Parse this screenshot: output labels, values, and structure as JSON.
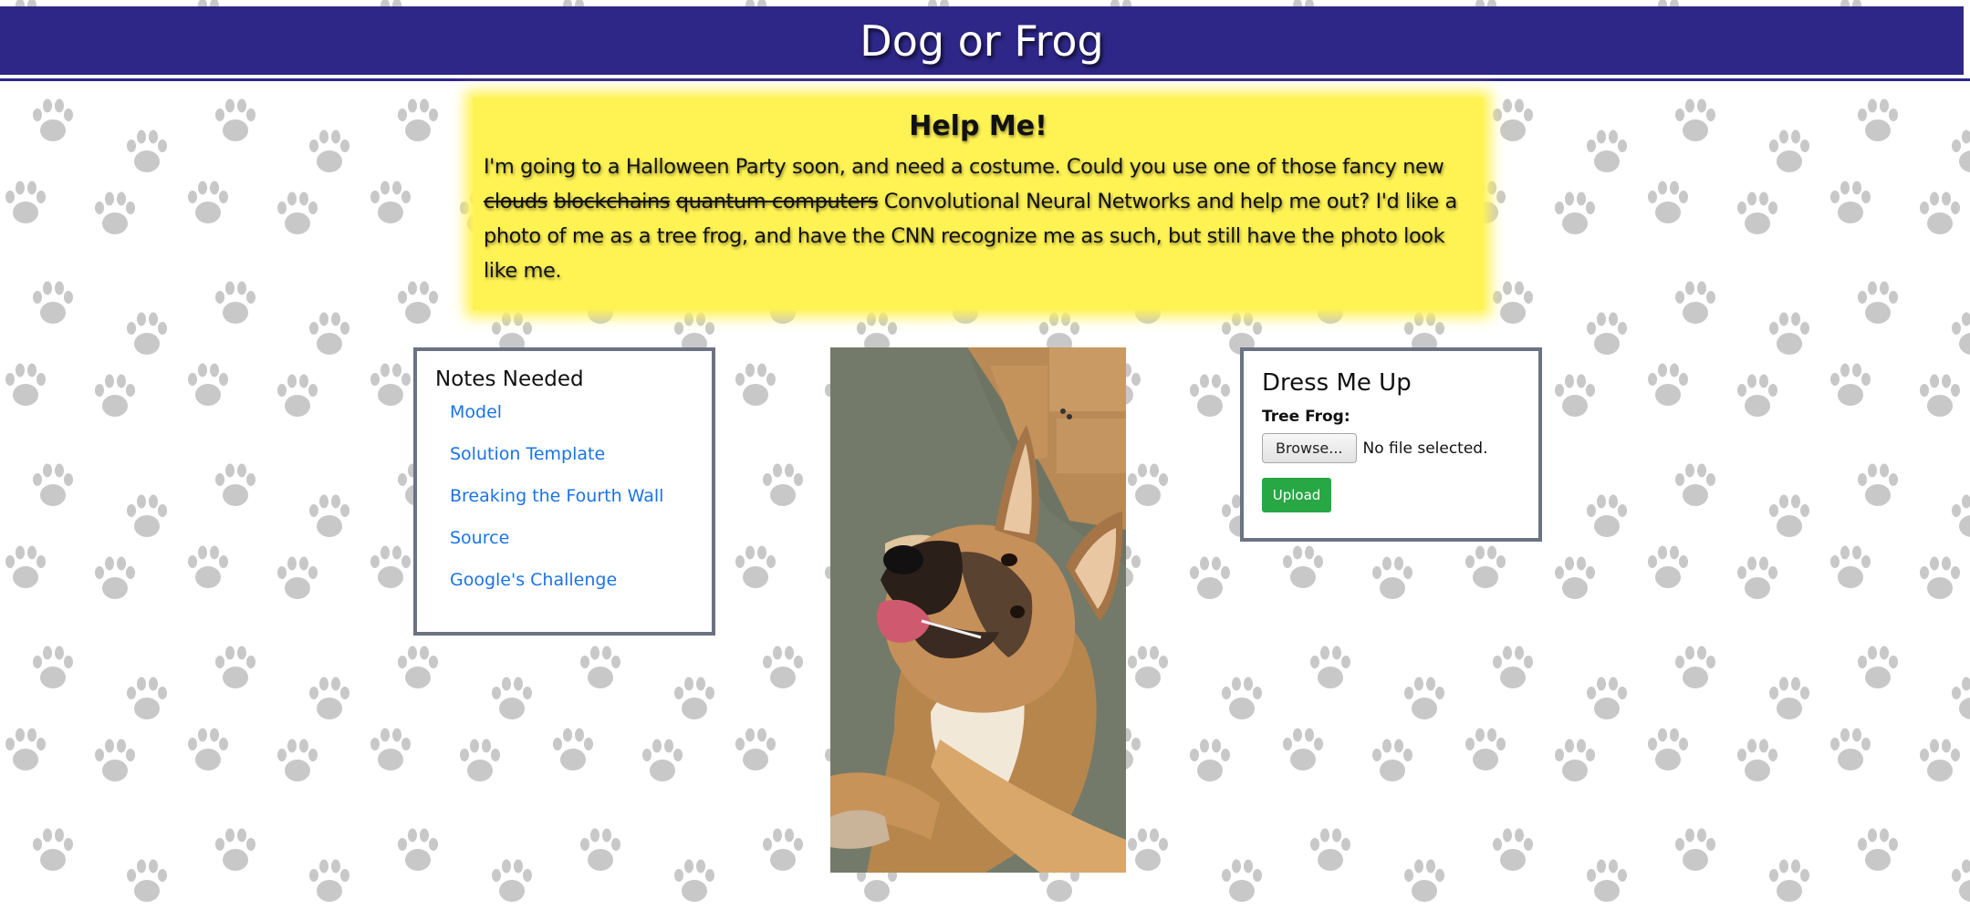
{
  "header": {
    "title": "Dog or Frog"
  },
  "help": {
    "title": "Help Me!",
    "text_before": "I'm going to a Halloween Party soon, and need a costume. Could you use one of those fancy new ",
    "struck_1": "clouds",
    "struck_2": "blockchains",
    "struck_3": "quantum computers",
    "text_after": " Convolutional Neural Networks and help me out? I'd like a photo of me as a tree frog, and have the CNN recognize me as such, but still have the photo look like me."
  },
  "notes": {
    "title": "Notes Needed",
    "links": [
      "Model",
      "Solution Template",
      "Breaking the Fourth Wall",
      "Source",
      "Google's Challenge"
    ]
  },
  "photo": {
    "subject": "dog-photo"
  },
  "dress": {
    "title": "Dress Me Up",
    "field_label": "Tree Frog:",
    "browse_label": "Browse...",
    "file_status": "No file selected.",
    "upload_label": "Upload"
  },
  "colors": {
    "header_bg": "#2e2788",
    "help_bg": "#fff354",
    "link": "#1a73e8",
    "upload_bg": "#28a745",
    "panel_border": "#6b7283",
    "paw": "#c8c8c8"
  }
}
